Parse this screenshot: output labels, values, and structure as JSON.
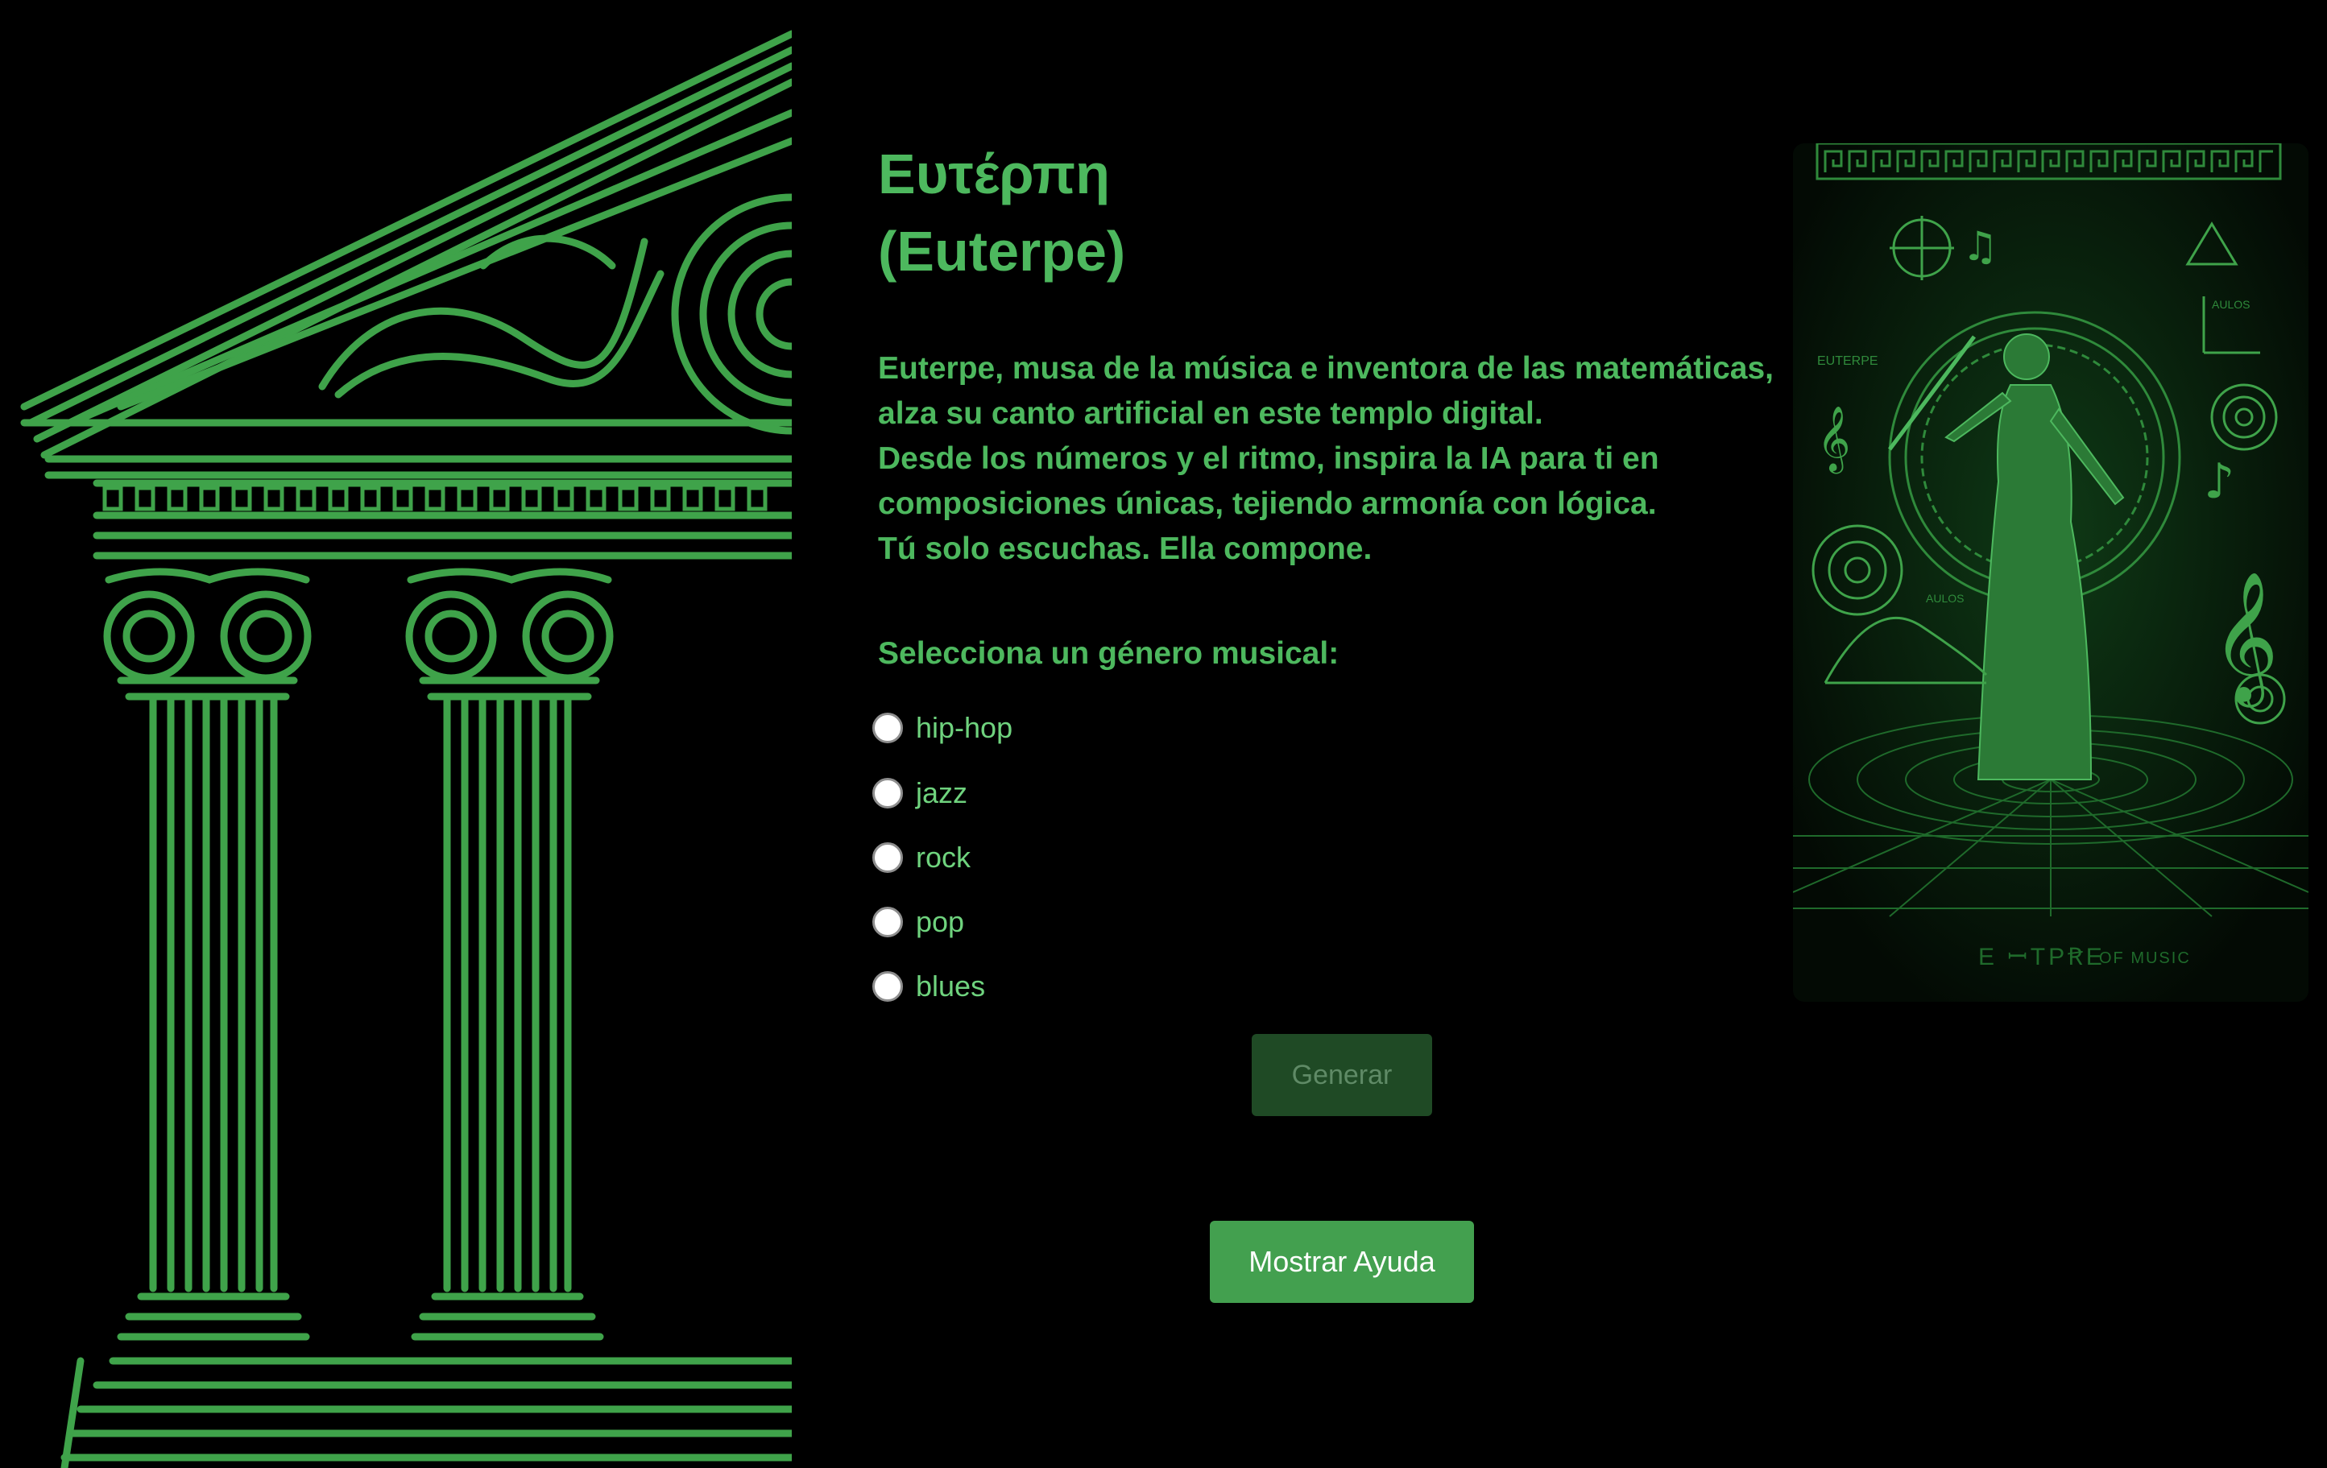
{
  "header": {
    "title_line1": "Ευτέρπη",
    "title_line2": "(Euterpe)"
  },
  "intro": {
    "lines": [
      "Euterpe, musa de la música e inventora de las matemáticas,",
      "alza su canto artificial en este templo digital.",
      "Desde los números y el ritmo, inspira la IA para ti en",
      "composiciones únicas, tejiendo armonía con lógica.",
      "Tú solo escuchas. Ella compone."
    ]
  },
  "genre_form": {
    "prompt": "Selecciona un género musical:",
    "options": [
      "hip-hop",
      "jazz",
      "rock",
      "pop",
      "blues"
    ],
    "selected": null
  },
  "actions": {
    "generate_label": "Generar",
    "generate_enabled": false,
    "help_label": "Mostrar Ayuda"
  },
  "illustration": {
    "labels": [
      "EUTERPE",
      "AULOS",
      "AULOS"
    ],
    "caption_main": "E ꟷTPꞦE",
    "caption_small": "OF MUSIC"
  },
  "colors": {
    "background": "#000000",
    "accent_green": "#4db85e",
    "line_green": "#3fa34a",
    "help_button": "#43a04f",
    "generate_disabled": "#1f4a25"
  }
}
